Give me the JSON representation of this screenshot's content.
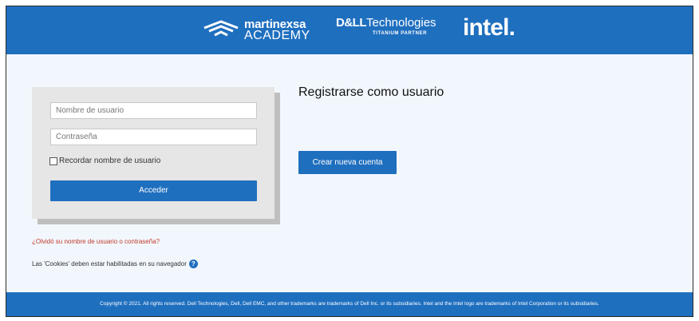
{
  "header": {
    "brand_martinexsa_name": "martinexsa",
    "brand_martinexsa_sub": "ACADEMY",
    "brand_dell_prefix": "D&LL",
    "brand_dell_suffix": "Technologies",
    "brand_dell_tagline": "TITANIUM PARTNER",
    "brand_intel": "intel."
  },
  "login": {
    "username_placeholder": "Nombre de usuario",
    "password_placeholder": "Contraseña",
    "remember_label": "Recordar nombre de usuario",
    "submit_label": "Acceder",
    "forgot_link": "¿Olvidó su nombre de usuario o contraseña?",
    "cookies_note": "Las 'Cookies' deben estar habilitadas en su navegador",
    "help_icon": "?"
  },
  "register": {
    "title": "Registrarse como usuario",
    "create_button": "Crear nueva cuenta"
  },
  "footer": {
    "copyright": "Copyright © 2021. All rights reserved. Dell Technologies, Dell, Dell EMC, and other trademarks are trademarks of Dell Inc. or its subsidiaries. Intel and the Intel logo are trademarks of Intel Corporation or its subsidiaries."
  },
  "colors": {
    "brand_blue": "#1f6fbf",
    "link_red": "#c0392b"
  }
}
